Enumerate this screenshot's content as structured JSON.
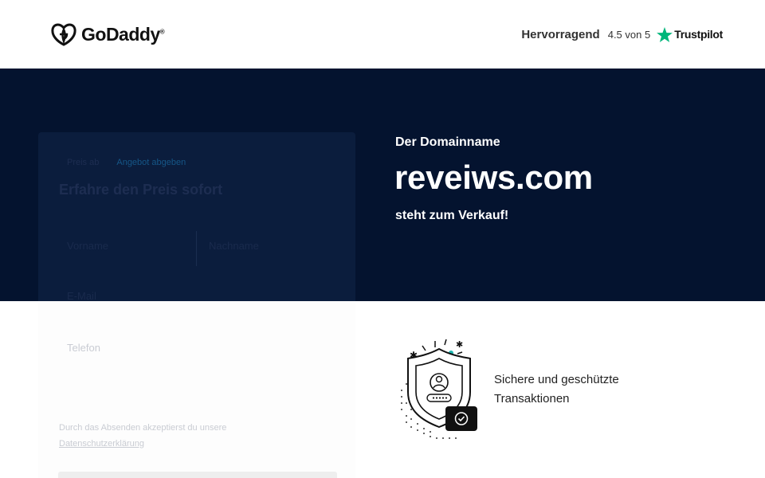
{
  "brand": {
    "logo_text": "GoDaddy",
    "logo_tm": "®"
  },
  "trustpilot": {
    "rating_word": "Hervorragend",
    "score": "4.5 von 5",
    "brand": "Trustpilot",
    "star_color": "#00b67a"
  },
  "hero": {
    "kicker": "Der Domainname",
    "domain": "reveiws.com",
    "sub": "steht zum Verkauf!",
    "background": "#04132f"
  },
  "form": {
    "step1": "Preis ab",
    "step2": "Angebot abgeben",
    "title": "Erfahre den Preis sofort",
    "first_name_placeholder": "Vorname",
    "last_name_placeholder": "Nachname",
    "email_placeholder": "E-Mail",
    "phone_placeholder": "Telefon",
    "terms_line1": "Durch das Absenden akzeptierst du unsere",
    "terms_line2": "Datenschutzerklärung"
  },
  "feature": {
    "text": "Sichere und geschützte Transaktionen",
    "icon": "shield-secure-icon"
  }
}
